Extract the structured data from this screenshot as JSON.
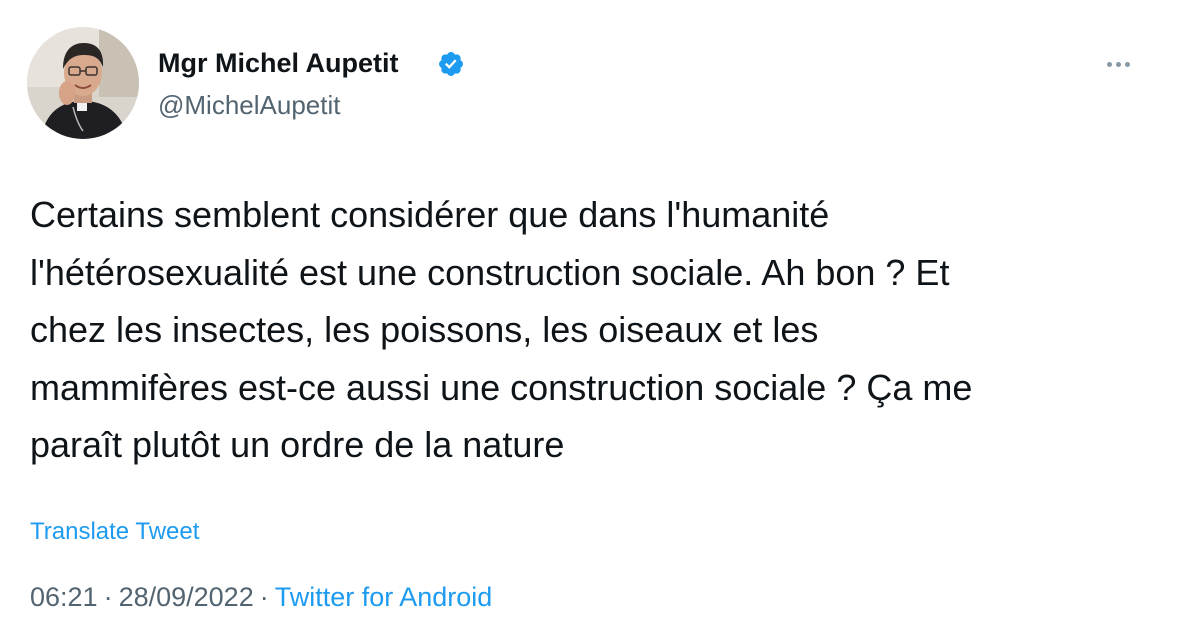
{
  "author": {
    "display_name": "Mgr Michel Aupetit",
    "handle": "@MichelAupetit",
    "verified": true
  },
  "tweet": {
    "text": "Certains semblent considérer que dans l'humanité\nl'hétérosexualité est une construction sociale. Ah bon ? Et\nchez les insectes, les poissons, les oiseaux et les\nmammifères est-ce aussi une construction sociale ? Ça me\nparaît plutôt un ordre de la nature",
    "translate_label": "Translate Tweet",
    "time": "06:21",
    "date": "28/09/2022",
    "separator": "·",
    "source": "Twitter for Android"
  },
  "icons": {
    "verified": "verified-badge-icon",
    "more": "more-options-icon"
  },
  "colors": {
    "accent": "#1d9bf0",
    "text": "#0f1419",
    "secondary": "#536471"
  }
}
